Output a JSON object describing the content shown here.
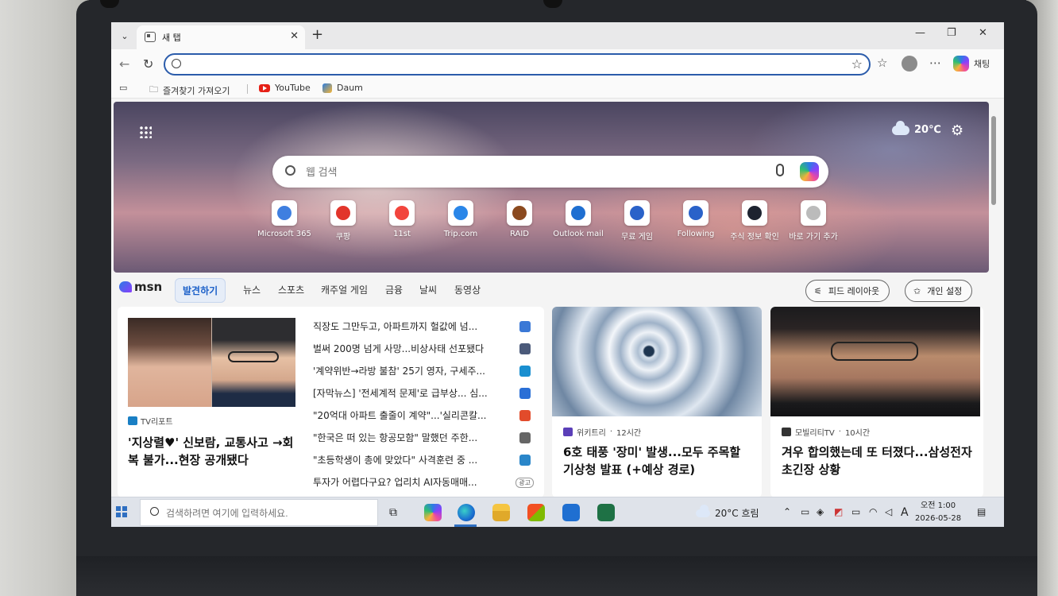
{
  "browser": {
    "tab_title": "새 탭",
    "address_value": "",
    "copilot_label": "채팅",
    "favorites": [
      "즐겨찾기 가져오기",
      "YouTube",
      "Daum"
    ]
  },
  "newtab": {
    "weather_temp": "20℃",
    "search_placeholder": "웹 검색",
    "tiles": [
      {
        "label": "Microsoft 365",
        "color": "#3f7fe0"
      },
      {
        "label": "쿠팡",
        "color": "#e2352b"
      },
      {
        "label": "11st",
        "color": "#f2453d"
      },
      {
        "label": "Trip.com",
        "color": "#2a86e8"
      },
      {
        "label": "RAID",
        "color": "#8b4a1f"
      },
      {
        "label": "Outlook mail",
        "color": "#1f6fd1"
      },
      {
        "label": "무료 게임",
        "color": "#2a62c9"
      },
      {
        "label": "Following",
        "color": "#2a62c9"
      },
      {
        "label": "주식 정보 확인",
        "color": "#1d2330"
      },
      {
        "label": "바로 가기 추가",
        "color": "#bbbbbb"
      }
    ]
  },
  "msn": {
    "logo": "msn",
    "tabs": [
      "발견하기",
      "뉴스",
      "스포츠",
      "캐주얼 게임",
      "금융",
      "날씨",
      "동영상"
    ],
    "feed_layout_label": "피드 레이아웃",
    "personalize_label": "개인 설정"
  },
  "lead_story": {
    "source": "TV리포트",
    "title": "'지상렬♥' 신보람, 교통사고 →회복 불가...현장 공개됐다"
  },
  "headlines": [
    {
      "text": "직장도 그만두고, 아파트까지 헐값에 넘...",
      "color": "#3a78d6"
    },
    {
      "text": "벌써 200명 넘게 사망...비상사태 선포됐다",
      "color": "#4b5a7a"
    },
    {
      "text": "'계약위반→라방 불참' 25기 영자, 구세주...",
      "color": "#1a8fd0"
    },
    {
      "text": "[자막뉴스] '전세계적 문제'로 급부상... 심...",
      "color": "#2a6fd6"
    },
    {
      "text": "\"20억대 아파트 출줄이 계약\"...'실리콘칼...",
      "color": "#e24b2b"
    },
    {
      "text": "\"한국은 떠 있는 항공모함\" 말했던 주한...",
      "color": "#666666"
    },
    {
      "text": "\"초등학생이 총에 맞았다\" 사격훈련 중 ...",
      "color": "#2a86c9"
    },
    {
      "text": "투자가 어렵다구요? 업리치 AI자동매매...",
      "color": "#ffffff",
      "ad": "광고"
    }
  ],
  "cards": [
    {
      "source": "위키트리",
      "time": "12시간",
      "title": "6호 태풍 '장미' 발생...모두 주목할 기상청 발표 (+예상 경로)",
      "src_color": "#5b3fb8"
    },
    {
      "source": "모빌리티TV",
      "time": "10시간",
      "title": "겨우 합의했는데 또 터졌다...삼성전자 초긴장 상황",
      "src_color": "#333333"
    }
  ],
  "taskbar": {
    "search_placeholder": "검색하려면 여기에 입력하세요.",
    "weather": "20°C 흐림",
    "ime": "A",
    "time": "오전 1:00",
    "date": "2026-05-28"
  }
}
